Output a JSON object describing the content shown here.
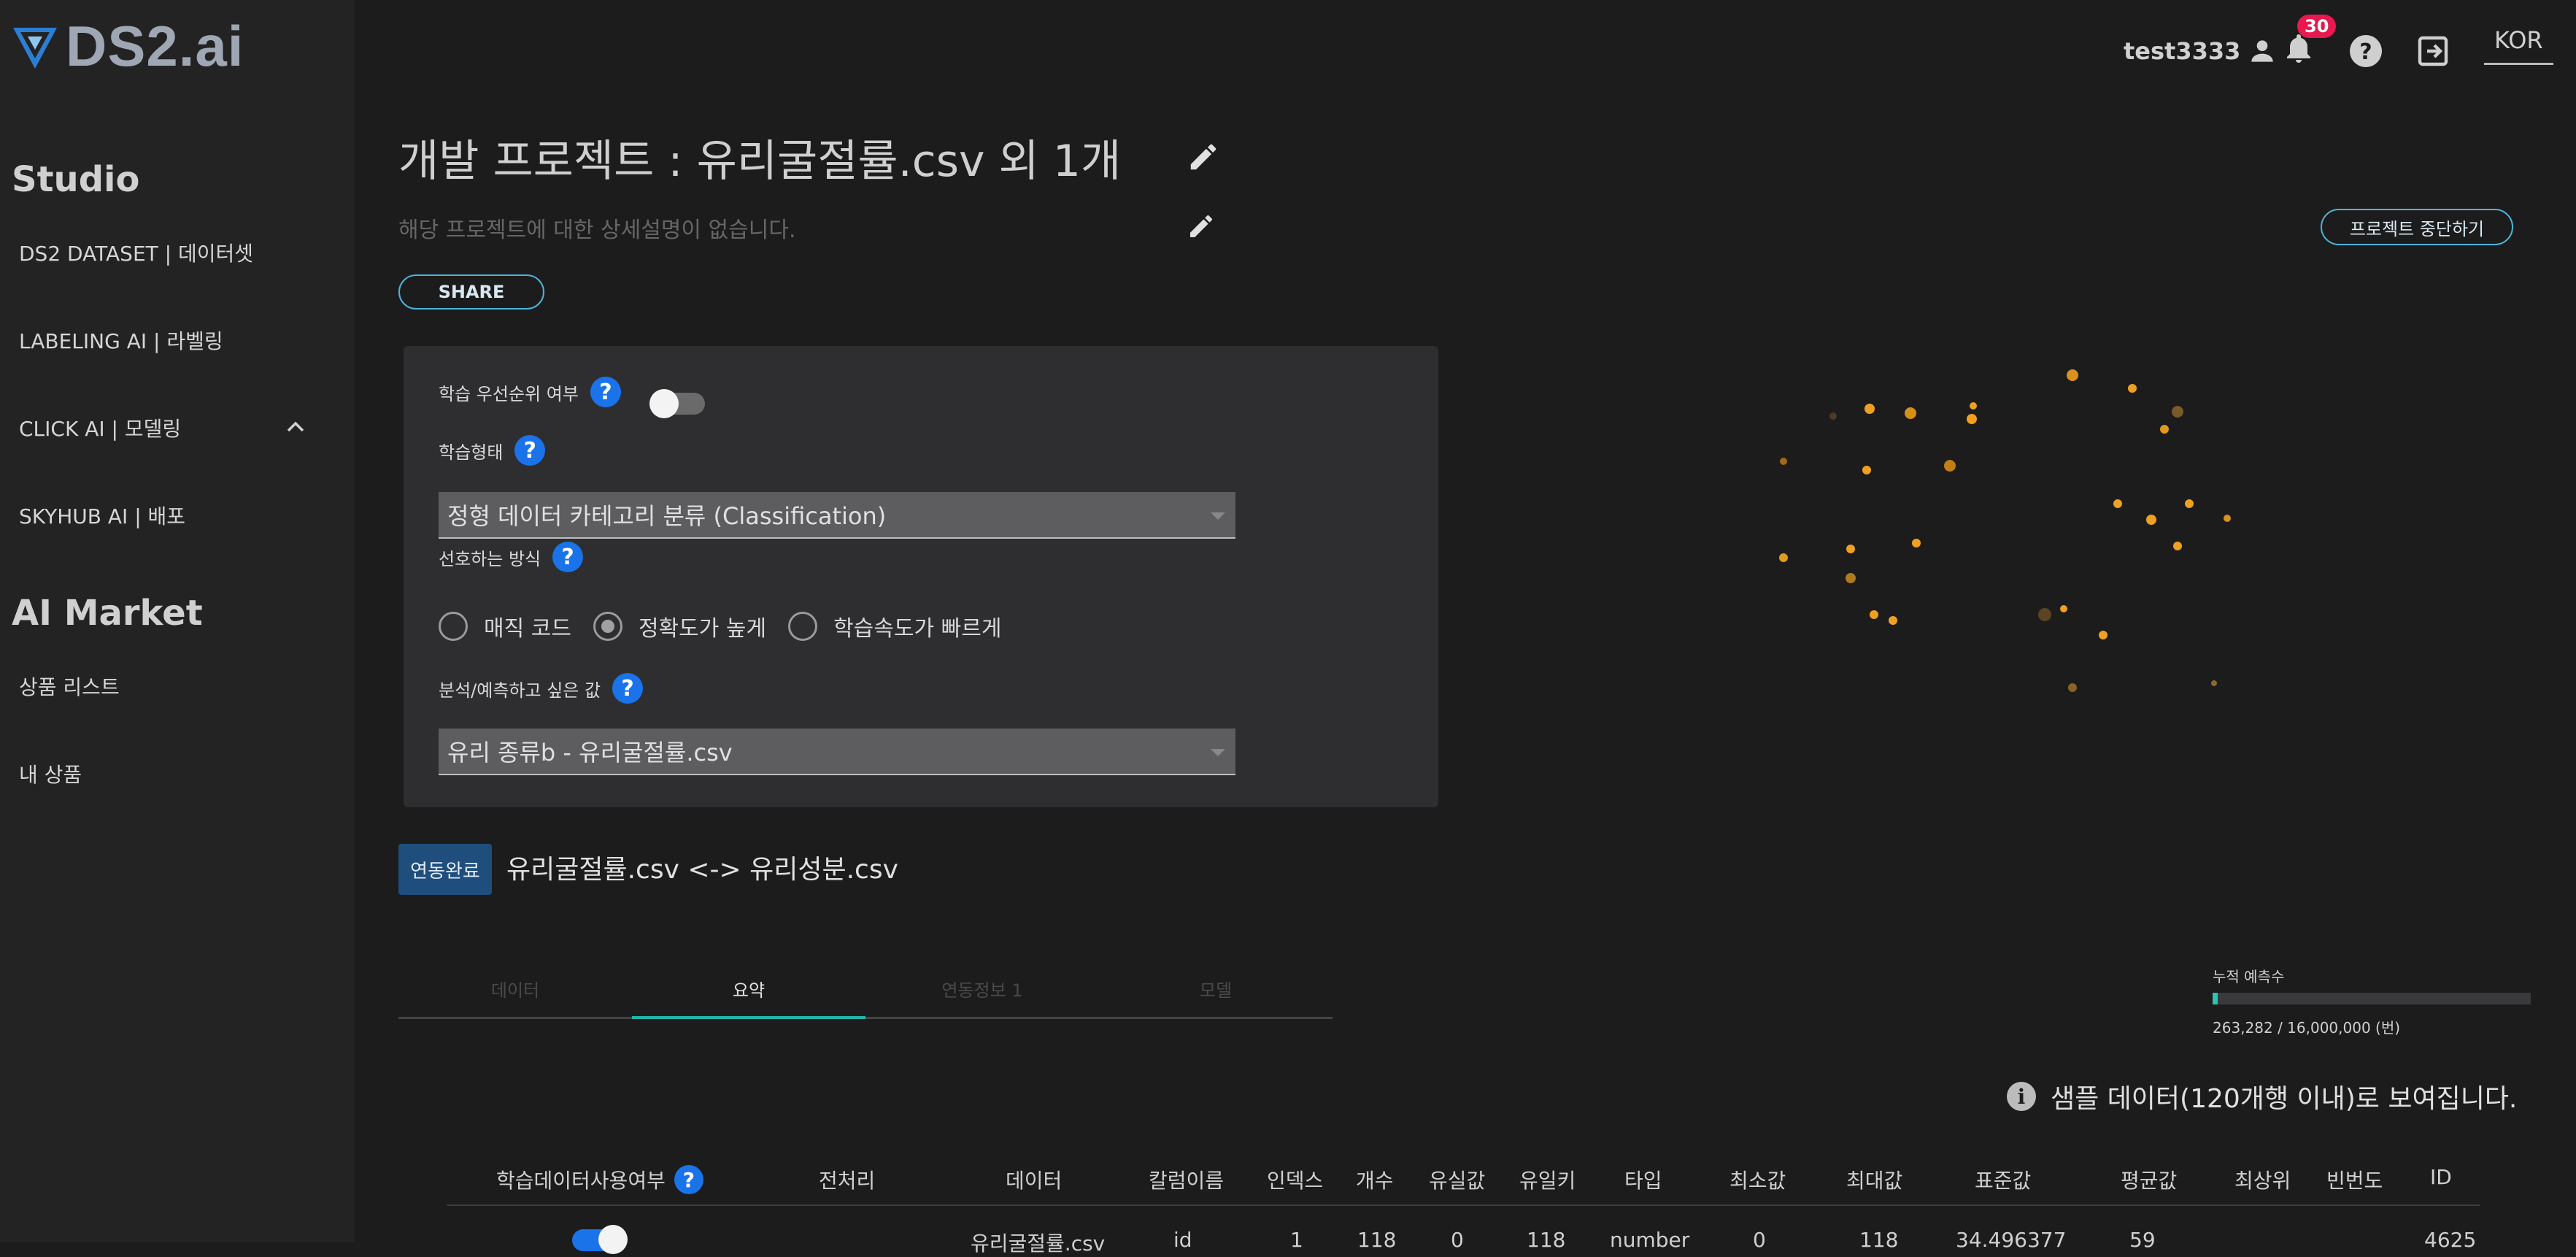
{
  "brand": {
    "name": "DS2.ai"
  },
  "sidebar": {
    "studio_title": "Studio",
    "studio_items": [
      {
        "label": "DS2 DATASET | 데이터셋"
      },
      {
        "label": "LABELING AI | 라벨링"
      },
      {
        "label": "CLICK AI | 모델링"
      },
      {
        "label": "SKYHUB AI | 배포"
      }
    ],
    "market_title": "AI Market",
    "market_items": [
      {
        "label": "상품 리스트"
      },
      {
        "label": "내 상품"
      }
    ]
  },
  "header": {
    "username": "test3333",
    "notification_count": "30",
    "language": "KOR"
  },
  "project": {
    "title": "개발 프로젝트 : 유리굴절률.csv 외 1개",
    "description": "해당 프로젝트에 대한 상세설명이 없습니다.",
    "share_label": "SHARE",
    "stop_label": "프로젝트 중단하기"
  },
  "settings": {
    "priority_label": "학습 우선순위 여부",
    "priority_enabled": false,
    "training_type_label": "학습형태",
    "training_type_value": "정형 데이터 카테고리 분류 (Classification)",
    "method_label": "선호하는 방식",
    "methods": [
      {
        "label": "매직 코드",
        "selected": false
      },
      {
        "label": "정확도가 높게",
        "selected": true
      },
      {
        "label": "학습속도가 빠르게",
        "selected": false
      }
    ],
    "target_label": "분석/예측하고 싶은 값",
    "target_value": "유리 종류b - 유리굴절률.csv",
    "help_glyph": "?"
  },
  "link": {
    "status": "연동완료",
    "text": "유리굴절률.csv <-> 유리성분.csv"
  },
  "tabs": [
    {
      "label": "데이터",
      "active": false
    },
    {
      "label": "요약",
      "active": true
    },
    {
      "label": "연동정보 1",
      "active": false
    },
    {
      "label": "모델",
      "active": false
    }
  ],
  "predictions": {
    "label": "누적 예측수",
    "value_text": "263,282 / 16,000,000 (번)",
    "fraction": 0.0165
  },
  "sample_note": "샘플 데이터(120개행 이내)로 보여집니다.",
  "table": {
    "headers": [
      "학습데이터사용여부",
      "전처리",
      "데이터",
      "칼럼이름",
      "인덱스",
      "개수",
      "유실값",
      "유일키",
      "타입",
      "최소값",
      "최대값",
      "표준값",
      "평균값",
      "최상위",
      "빈번도",
      "ID"
    ],
    "row": [
      "유리굴절률.csv",
      "id",
      "1",
      "118",
      "0",
      "118",
      "number",
      "0",
      "118",
      "34.496377",
      "59",
      "",
      "",
      "4625"
    ]
  },
  "colors": {
    "accent": "#1a73e8",
    "teal": "#1fb5a8",
    "badge": "#e8194f",
    "dot": "#f0a020"
  }
}
